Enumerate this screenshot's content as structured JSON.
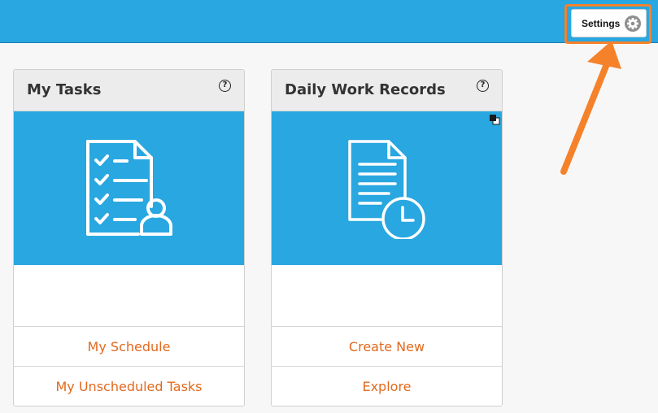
{
  "header": {
    "settings_label": "Settings",
    "settings_icon": "gear-icon",
    "accent_color": "#29a7e1",
    "highlight_color": "#f5822a"
  },
  "cards": [
    {
      "title": "My Tasks",
      "help_glyph": "?",
      "icon": "task-checklist-user-icon",
      "links": [
        "My Schedule",
        "My Unscheduled Tasks"
      ]
    },
    {
      "title": "Daily Work Records",
      "help_glyph": "?",
      "icon": "document-clock-icon",
      "links": [
        "Create New",
        "Explore"
      ]
    }
  ],
  "link_color": "#e2691d"
}
